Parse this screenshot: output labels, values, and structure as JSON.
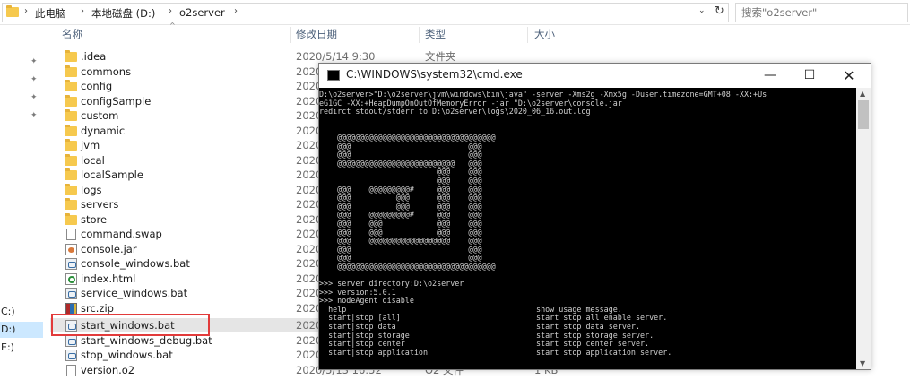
{
  "address_bar": {
    "breadcrumb": [
      "此电脑",
      "本地磁盘 (D:)",
      "o2server"
    ],
    "search_placeholder": "搜索\"o2server\""
  },
  "navigation": {
    "drives": [
      "C:)",
      "D:)",
      "E:)"
    ]
  },
  "columns": {
    "name": "名称",
    "date": "修改日期",
    "type": "类型",
    "size": "大小"
  },
  "files": [
    {
      "name": ".idea",
      "date": "2020/5/14 9:30",
      "type": "文件夹",
      "size": "",
      "icon": "folder"
    },
    {
      "name": "commons",
      "date": "2020",
      "type": "",
      "size": "",
      "icon": "folder"
    },
    {
      "name": "config",
      "date": "2020",
      "type": "",
      "size": "",
      "icon": "folder"
    },
    {
      "name": "configSample",
      "date": "2020",
      "type": "",
      "size": "",
      "icon": "folder"
    },
    {
      "name": "custom",
      "date": "2020",
      "type": "",
      "size": "",
      "icon": "folder"
    },
    {
      "name": "dynamic",
      "date": "2020",
      "type": "",
      "size": "",
      "icon": "folder"
    },
    {
      "name": "jvm",
      "date": "2020",
      "type": "",
      "size": "",
      "icon": "folder"
    },
    {
      "name": "local",
      "date": "2020",
      "type": "",
      "size": "",
      "icon": "folder"
    },
    {
      "name": "localSample",
      "date": "2020",
      "type": "",
      "size": "",
      "icon": "folder"
    },
    {
      "name": "logs",
      "date": "2020",
      "type": "",
      "size": "",
      "icon": "folder"
    },
    {
      "name": "servers",
      "date": "2020",
      "type": "",
      "size": "",
      "icon": "folder"
    },
    {
      "name": "store",
      "date": "2020",
      "type": "",
      "size": "",
      "icon": "folder"
    },
    {
      "name": "command.swap",
      "date": "2020",
      "type": "",
      "size": "",
      "icon": "file"
    },
    {
      "name": "console.jar",
      "date": "2020",
      "type": "",
      "size": "",
      "icon": "jar"
    },
    {
      "name": "console_windows.bat",
      "date": "2020",
      "type": "",
      "size": "",
      "icon": "bat"
    },
    {
      "name": "index.html",
      "date": "2020",
      "type": "",
      "size": "",
      "icon": "html"
    },
    {
      "name": "service_windows.bat",
      "date": "2020",
      "type": "",
      "size": "",
      "icon": "bat"
    },
    {
      "name": "src.zip",
      "date": "2020",
      "type": "",
      "size": "",
      "icon": "zip"
    },
    {
      "name": "start_windows.bat",
      "date": "2020",
      "type": "",
      "size": "",
      "icon": "bat"
    },
    {
      "name": "start_windows_debug.bat",
      "date": "2020",
      "type": "",
      "size": "",
      "icon": "bat"
    },
    {
      "name": "stop_windows.bat",
      "date": "2020",
      "type": "",
      "size": "",
      "icon": "bat"
    },
    {
      "name": "version.o2",
      "date": "2020/5/13 16:52",
      "type": "O2 文件",
      "size": "1 KB",
      "icon": "file"
    }
  ],
  "cmd_window": {
    "title": "C:\\WINDOWS\\system32\\cmd.exe",
    "minimize": "—",
    "maximize": "☐",
    "close": "✕",
    "output": "D:\\o2server>\"D:\\o2server\\jvm\\windows\\bin\\java\" -server -Xms2g -Xmx5g -Duser.timezone=GMT+08 -XX:+Us\neG1GC -XX:+HeapDumpOnOutOfMemoryError -jar \"D:\\o2server\\console.jar\nredirct stdout/stderr to D:\\o2server\\logs\\2020_06_16.out.log\n\n\n    @@@@@@@@@@@@@@@@@@@@@@@@@@@@@@@@@@@\n    @@@                          @@@\n    @@@                          @@@\n    @@@@@@@@@@@@@@@@@@@@@@@@@@   @@@\n                          @@@    @@@\n                          @@@    @@@\n    @@@    @@@@@@@@@#     @@@    @@@\n    @@@          @@@      @@@    @@@\n    @@@          @@@      @@@    @@@\n    @@@    @@@@@@@@@#     @@@    @@@\n    @@@    @@@            @@@    @@@\n    @@@    @@@            @@@    @@@\n    @@@    @@@@@@@@@@@@@@@@@@    @@@\n    @@@                          @@@\n    @@@                          @@@\n    @@@@@@@@@@@@@@@@@@@@@@@@@@@@@@@@@@@\n\n>>> server directory:D:\\o2server\n>>> version:5.0.1\n>>> nodeAgent disable\n  help                                          show usage message.\n  start|stop [all]                              start stop all enable server.\n  start|stop data                               start stop data server.\n  start|stop storage                            start stop storage server.\n  start|stop center                             start stop center server.\n  start|stop application                        start stop application server."
  }
}
